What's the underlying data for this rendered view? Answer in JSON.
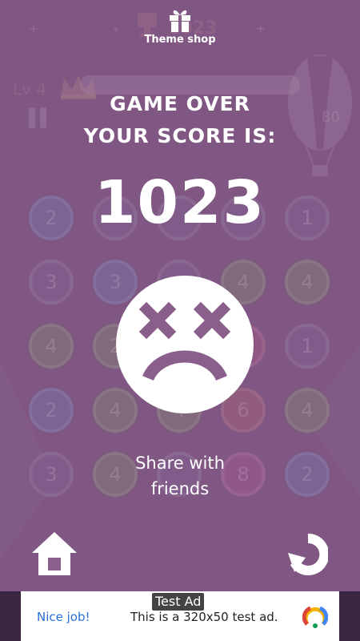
{
  "theme_shop": {
    "label": "Theme shop",
    "icon": "gift-icon"
  },
  "hud": {
    "level": "Lv 4",
    "best_score": "1023",
    "score_behind": "1023",
    "side_badge": "80"
  },
  "game_over": {
    "line1": "GAME OVER",
    "line2": "YOUR SCORE IS:",
    "score": "1023"
  },
  "share": {
    "line1": "Share with",
    "line2": "friends"
  },
  "board": {
    "rows": [
      [
        "2",
        "",
        "",
        "",
        "1"
      ],
      [
        "3",
        "3",
        "",
        "4",
        "4"
      ],
      [
        "4",
        "2",
        "",
        "",
        "1"
      ],
      [
        "2",
        "4",
        "4",
        "6",
        "4"
      ],
      [
        "3",
        "4",
        "",
        "8",
        "2"
      ]
    ]
  },
  "buttons": {
    "home_icon": "home-icon",
    "restart_icon": "restart-icon"
  },
  "ad": {
    "tag": "Test Ad",
    "cta": "Nice job!",
    "text": "This is a 320x50 test ad."
  },
  "colors": {
    "overlay": "#8a5f8b",
    "text": "#ffffff",
    "ad_link": "#2a6fdb"
  }
}
